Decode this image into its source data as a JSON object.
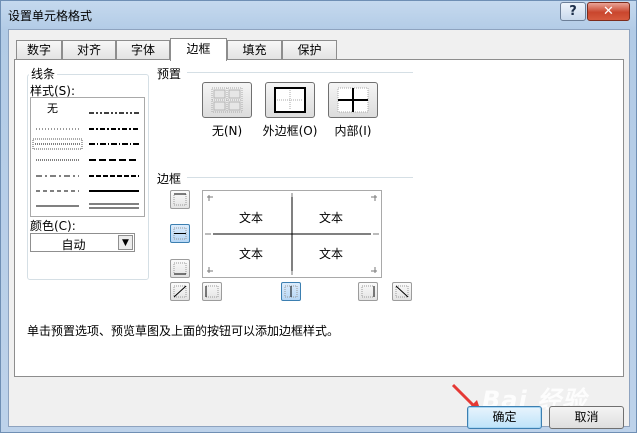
{
  "window": {
    "title": "设置单元格格式"
  },
  "titlebar": {
    "help": "?",
    "close": "✕"
  },
  "tabs": [
    {
      "label": "数字"
    },
    {
      "label": "对齐"
    },
    {
      "label": "字体"
    },
    {
      "label": "边框"
    },
    {
      "label": "填充"
    },
    {
      "label": "保护"
    }
  ],
  "active_tab": "边框",
  "line": {
    "group_label": "线条",
    "style_label": "样式(S):",
    "style_none": "无",
    "color_label": "颜色(C):",
    "color_value": "自动",
    "dropdown_glyph": "▼"
  },
  "presets": {
    "label": "预置",
    "items": [
      {
        "label": "无(N)",
        "icon": "border-none-icon"
      },
      {
        "label": "外边框(O)",
        "icon": "border-outline-icon"
      },
      {
        "label": "内部(I)",
        "icon": "border-inside-icon"
      }
    ]
  },
  "border": {
    "label": "边框",
    "preview_text": [
      "文本",
      "文本",
      "文本",
      "文本"
    ]
  },
  "hint": "单击预置选项、预览草图及上面的按钮可以添加边框样式。",
  "buttons": {
    "ok": "确定",
    "cancel": "取消"
  },
  "watermark": "Bai 经验",
  "colors": {
    "accent": "#3c7fb1",
    "close": "#c9462d",
    "arrow": "#e53935"
  }
}
